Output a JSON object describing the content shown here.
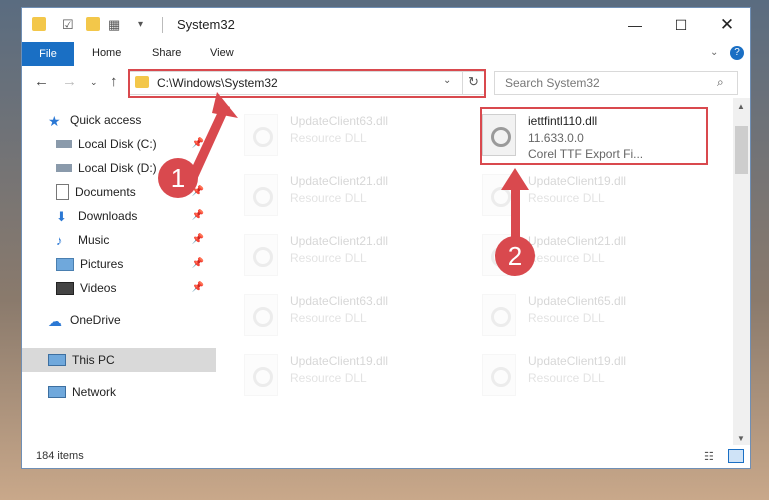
{
  "window": {
    "title": "System32"
  },
  "ribbon": {
    "file": "File",
    "home": "Home",
    "share": "Share",
    "view": "View"
  },
  "address": {
    "path": "C:\\Windows\\System32",
    "search_placeholder": "Search System32"
  },
  "nav": {
    "items": [
      {
        "label": "Quick access",
        "icon": "star-icon"
      },
      {
        "label": "Local Disk (C:)",
        "icon": "drive-icon"
      },
      {
        "label": "Local Disk (D:)",
        "icon": "drive-icon"
      },
      {
        "label": "Documents",
        "icon": "documents-icon"
      },
      {
        "label": "Downloads",
        "icon": "download-icon"
      },
      {
        "label": "Music",
        "icon": "music-icon"
      },
      {
        "label": "Pictures",
        "icon": "pictures-icon"
      },
      {
        "label": "Videos",
        "icon": "videos-icon"
      },
      {
        "label": "OneDrive",
        "icon": "cloud-icon"
      },
      {
        "label": "This PC",
        "icon": "computer-icon"
      },
      {
        "label": "Network",
        "icon": "network-icon"
      }
    ]
  },
  "files": {
    "highlighted": {
      "name": "iettfintl110.dll",
      "version": "11.633.0.0",
      "desc": "Corel TTF Export Fi..."
    },
    "left": [
      {
        "name": "UpdateClient63.dll",
        "type": "Resource DLL"
      },
      {
        "name": "UpdateClient21.dll",
        "type": "Resource DLL"
      },
      {
        "name": "UpdateClient21.dll",
        "type": "Resource DLL"
      },
      {
        "name": "UpdateClient63.dll",
        "type": "Resource DLL"
      },
      {
        "name": "UpdateClient19.dll",
        "type": "Resource DLL"
      }
    ],
    "right": [
      {
        "name": "UpdateClient19.dll",
        "type": "Resource DLL"
      },
      {
        "name": "UpdateClient21.dll",
        "type": "Resource DLL"
      },
      {
        "name": "UpdateClient65.dll",
        "type": "Resource DLL"
      },
      {
        "name": "UpdateClient19.dll",
        "type": "Resource DLL"
      }
    ]
  },
  "status": {
    "count": "184 items"
  },
  "callouts": {
    "one": "1",
    "two": "2"
  },
  "colors": {
    "accent": "#1a6fc4",
    "highlight_red": "#d9494e"
  }
}
